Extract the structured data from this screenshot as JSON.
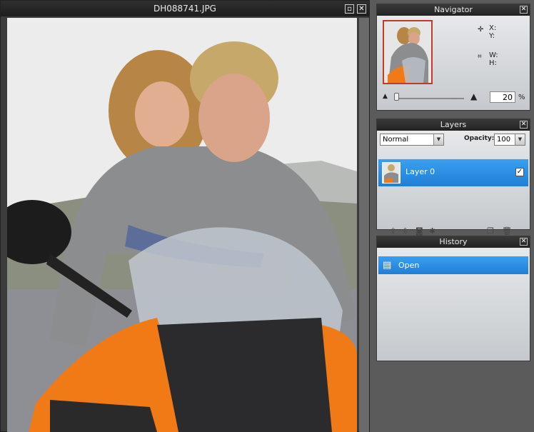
{
  "document": {
    "title": "DH088741.JPG",
    "maximize_icon": "maximize-icon",
    "close_icon": "close-icon"
  },
  "navigator": {
    "title": "Navigator",
    "x_label": "X:",
    "y_label": "Y:",
    "w_label": "W:",
    "h_label": "H:",
    "zoom_value": "20",
    "zoom_unit": "%"
  },
  "layers": {
    "title": "Layers",
    "blend_mode": "Normal",
    "opacity_label": "Opacity:",
    "opacity_value": "100",
    "items": [
      {
        "name": "Layer 0",
        "visible": true
      }
    ]
  },
  "history": {
    "title": "History",
    "items": [
      {
        "label": "Open"
      }
    ]
  },
  "colors": {
    "selection": "#2b8be3",
    "panel_bg": "#cfd3d7",
    "titlebar": "#222222"
  }
}
